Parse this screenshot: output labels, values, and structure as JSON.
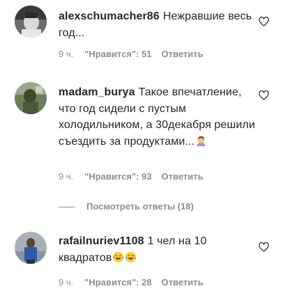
{
  "comments": [
    {
      "username": "alexschumacher86",
      "text": "Нежравшие весь год...",
      "time": "9 ч.",
      "likes": "\"Нравится\": 51",
      "reply": "Ответить",
      "avatar_icon": "user-avatar"
    },
    {
      "username": "madam_burya",
      "text": "Такое впечатление, что год сидели с пустым холодильником, а 30декабря решили съездить за продуктами...",
      "emoji": "facepalm-woman-emoji",
      "time": "9 ч.",
      "likes": "\"Нравится\": 93",
      "reply": "Ответить",
      "avatar_icon": "user-avatar"
    },
    {
      "username": "rafailnuriev1108",
      "text": "1 чел на 10 квадратов",
      "emoji": "tears-of-joy-emoji x2",
      "time": "9 ч.",
      "likes": "\"Нравится\": 28",
      "reply": "Ответить",
      "avatar_icon": "user-avatar"
    }
  ],
  "view_replies_label": "Посмотреть ответы (18)",
  "icons": {
    "like": "heart-icon"
  },
  "colors": {
    "text": "#262626",
    "secondary": "#8e8e8e",
    "background": "#ffffff"
  }
}
